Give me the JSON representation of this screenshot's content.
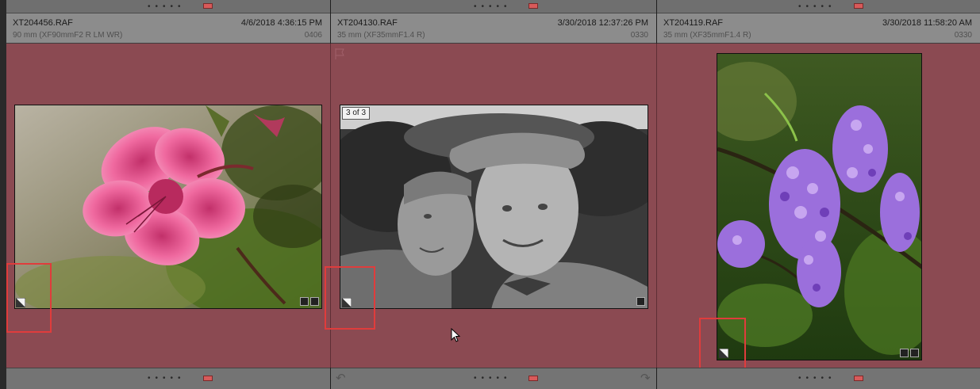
{
  "cells": [
    {
      "filename": "XT204456.RAF",
      "datetime": "4/6/2018 4:36:15 PM",
      "lens": "90 mm (XF90mmF2 R LM WR)",
      "number": "0406"
    },
    {
      "filename": "XT204130.RAF",
      "datetime": "3/30/2018 12:37:26 PM",
      "lens": "35 mm (XF35mmF1.4 R)",
      "number": "0330",
      "stack_label": "3 of 3"
    },
    {
      "filename": "XT204119.RAF",
      "datetime": "3/30/2018 11:58:20 AM",
      "lens": "35 mm (XF35mmF1.4 R)",
      "number": "0330"
    }
  ],
  "colors": {
    "selection_bg": "#8b4a52",
    "highlight_box": "#e03c3c",
    "flag": "#d85a5a"
  },
  "icons": [
    "flag-icon",
    "keyword-icon",
    "develop-adjusted-icon",
    "rotate-left-icon",
    "rotate-right-icon",
    "collection-badge-icon"
  ]
}
